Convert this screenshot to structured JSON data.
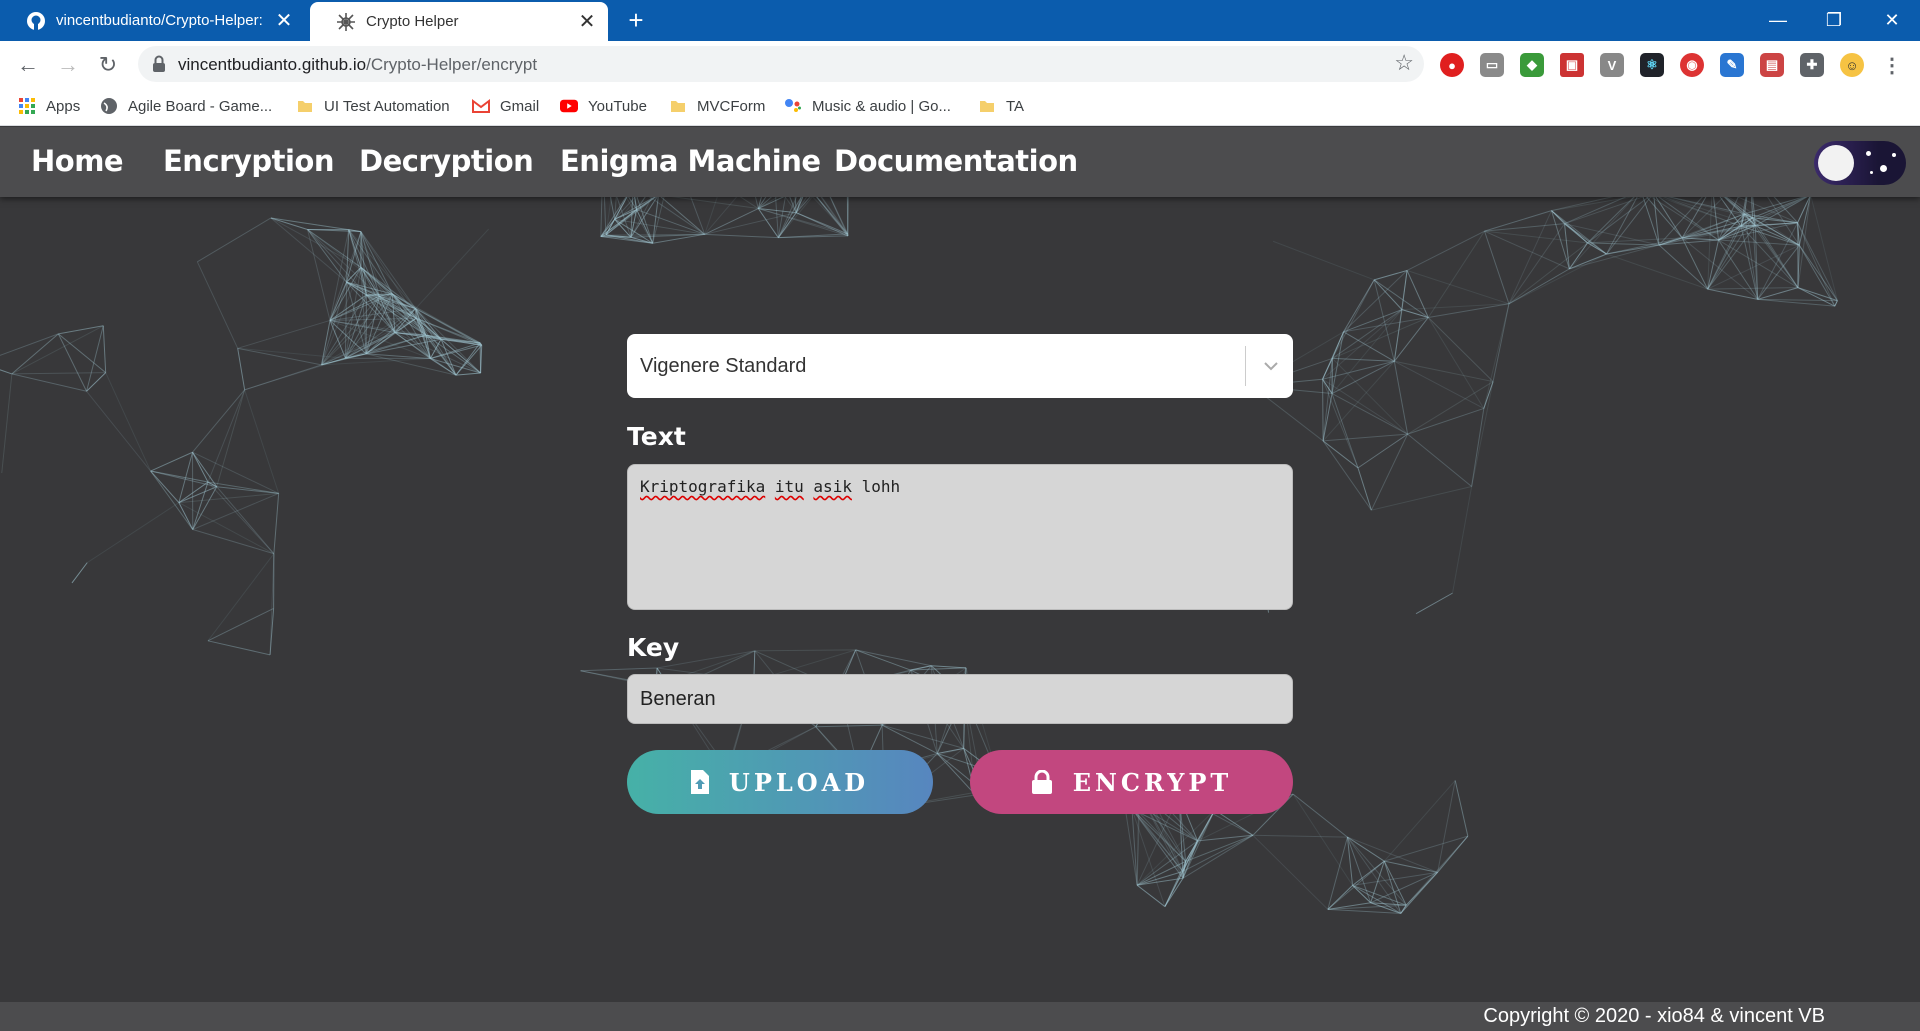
{
  "browser": {
    "tabs": [
      {
        "title": "vincentbudianto/Crypto-Helper: ",
        "favicon": "github-icon",
        "active": false
      },
      {
        "title": "Crypto Helper",
        "favicon": "crypto-helper-icon",
        "active": true
      }
    ],
    "url_host": "vincentbudianto.github.io",
    "url_path": "/Crypto-Helper/encrypt",
    "bookmarks": [
      {
        "label": "Apps",
        "icon": "apps-grid-icon"
      },
      {
        "label": "Agile Board - Game...",
        "icon": "globe-icon"
      },
      {
        "label": "UI Test Automation",
        "icon": "folder-icon"
      },
      {
        "label": "Gmail",
        "icon": "gmail-icon"
      },
      {
        "label": "YouTube",
        "icon": "youtube-icon"
      },
      {
        "label": "MVCForm",
        "icon": "folder-icon"
      },
      {
        "label": "Music & audio | Go...",
        "icon": "google-assistant-icon"
      },
      {
        "label": "TA",
        "icon": "folder-icon"
      }
    ]
  },
  "nav": {
    "links": [
      "Home",
      "Encryption",
      "Decryption",
      "Enigma Machine",
      "Documentation"
    ]
  },
  "form": {
    "cipher_selected": "Vigenere Standard",
    "text_label": "Text",
    "text_words": [
      "Kriptografika",
      "itu",
      "asik",
      "lohh"
    ],
    "key_label": "Key",
    "key_value": "Beneran",
    "upload_label": "UPLOAD",
    "encrypt_label": "ENCRYPT"
  },
  "footer": {
    "copyright": "Copyright © 2020 - xio84 & vincent VB"
  },
  "colors": {
    "tabbar": "#0b5cad",
    "navbar": "#4c4c4e",
    "background": "#38383a",
    "upload_gradient": [
      "#46b1a7",
      "#5786bf"
    ],
    "encrypt": "#c2477f"
  }
}
